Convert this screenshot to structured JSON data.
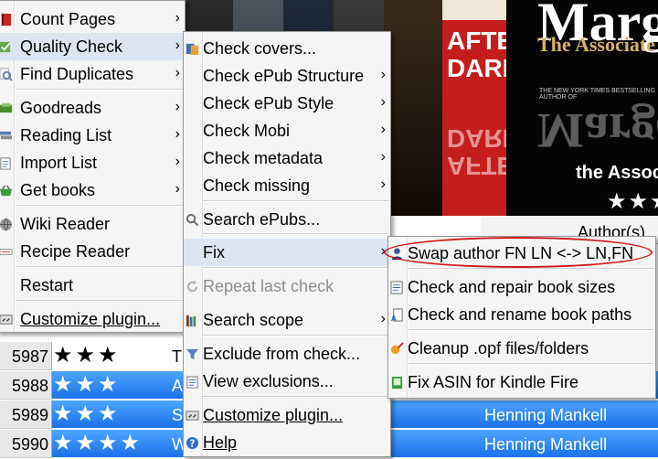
{
  "library": {
    "cover_titles": {
      "after_dark": "AFTER DARK",
      "margolin": "Margolin",
      "the_associate": "The Associate",
      "tagline": "THE NEW YORK TIMES BESTSELLING AUTHOR OF",
      "title_partial": "the Associ"
    },
    "column_header": "Author(s)",
    "rows": [
      {
        "index": "5987",
        "stars": "★★★",
        "title": "T",
        "author": "",
        "selected": false
      },
      {
        "index": "5988",
        "stars": "★★★",
        "title": "A",
        "author": "",
        "selected": true
      },
      {
        "index": "5989",
        "stars": "★★★",
        "title": "S",
        "author": "Henning Mankell",
        "selected": true
      },
      {
        "index": "5990",
        "stars": "★★★★",
        "title": "W",
        "author": "Henning Mankell",
        "selected": true
      }
    ]
  },
  "main_menu": {
    "items": [
      {
        "label": "Count Pages",
        "icon": "book-icon"
      },
      {
        "label": "Quality Check",
        "icon": "quality-check-icon"
      },
      {
        "label": "Find Duplicates",
        "icon": "magnifier-icon"
      },
      {
        "label": "Goodreads",
        "icon": "goodreads-icon"
      },
      {
        "label": "Reading List",
        "icon": "reading-list-icon"
      },
      {
        "label": "Import List",
        "icon": "import-list-icon"
      },
      {
        "label": "Get books",
        "icon": "basket-icon"
      },
      {
        "label": "Wiki Reader",
        "icon": "globe-icon"
      },
      {
        "label": "Recipe Reader",
        "icon": "recipe-icon"
      },
      {
        "label": "Restart",
        "icon": ""
      },
      {
        "label": "Customize plugin...",
        "icon": "customize-icon"
      }
    ]
  },
  "quality_menu": {
    "items": [
      {
        "label": "Check covers...",
        "icon": "covers-icon"
      },
      {
        "label": "Check ePub Structure"
      },
      {
        "label": "Check ePub Style"
      },
      {
        "label": "Check Mobi"
      },
      {
        "label": "Check metadata"
      },
      {
        "label": "Check missing"
      },
      {
        "label": "Search ePubs...",
        "icon": "search-icon"
      },
      {
        "label": "Fix"
      },
      {
        "label": "Repeat last check",
        "icon": "repeat-icon"
      },
      {
        "label": "Search scope",
        "icon": "books-icon"
      },
      {
        "label": "Exclude from check...",
        "icon": "filter-icon"
      },
      {
        "label": "View exclusions...",
        "icon": "view-exclusions-icon"
      },
      {
        "label": "Customize plugin...",
        "icon": "customize-icon"
      },
      {
        "label": "Help",
        "icon": "help-icon"
      }
    ]
  },
  "fix_menu": {
    "items": [
      {
        "label": "Swap author FN LN <-> LN,FN",
        "icon": "user-icon"
      },
      {
        "label": "Check and repair book sizes",
        "icon": "book-size-icon"
      },
      {
        "label": "Check and rename book paths",
        "icon": "book-path-icon"
      },
      {
        "label": "Cleanup .opf files/folders",
        "icon": "cleanup-icon"
      },
      {
        "label": "Fix ASIN for Kindle Fire",
        "icon": "kindle-icon"
      }
    ]
  },
  "colors": {
    "selection": "#2b85f2",
    "highlight_circle": "#d01818",
    "menu_hover": "#dce6f2"
  }
}
